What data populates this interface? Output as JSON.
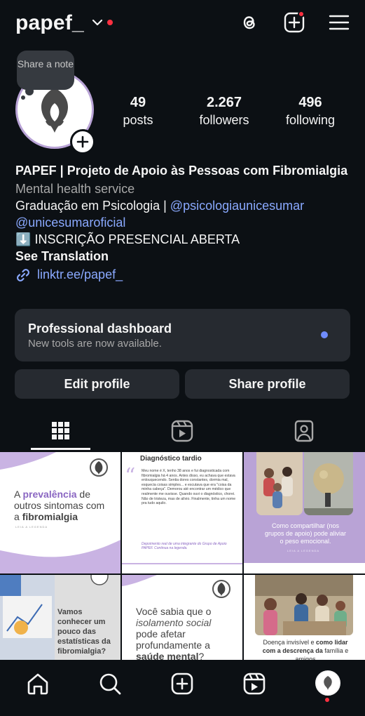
{
  "header": {
    "username": "papef_",
    "icons": [
      "chevron-down-icon",
      "threads-icon",
      "create-icon",
      "menu-icon"
    ]
  },
  "note": {
    "text": "Share a note"
  },
  "stats": [
    {
      "value": "49",
      "label": "posts"
    },
    {
      "value": "2.267",
      "label": "followers"
    },
    {
      "value": "496",
      "label": "following"
    }
  ],
  "bio": {
    "name": "PAPEF | Projeto de Apoio às Pessoas com Fibromialgia",
    "category": "Mental health service",
    "line1": "Graduação em Psicologia | ",
    "mention1": "@psicologiaunicesumar",
    "mention2": "@unicesumaroficial",
    "line3_emoji": "⬇️",
    "line3": "INSCRIÇÃO PRESENCIAL ABERTA",
    "see_translation": "See Translation",
    "link": "linktr.ee/papef_"
  },
  "dashboard": {
    "title": "Professional dashboard",
    "subtitle": "New tools are now available."
  },
  "buttons": {
    "edit": "Edit profile",
    "share": "Share profile"
  },
  "tabs": [
    "grid-icon",
    "reels-icon",
    "tagged-icon"
  ],
  "posts": [
    {
      "text_a": "A ",
      "text_b": "prevalência",
      "text_c": " de outros sintomas com a ",
      "text_d": "fibromialgia",
      "caption": "LEIA A LEGENDA"
    },
    {
      "title": "Diagnóstico tardio",
      "body": "Meu nome é X, tenho 38 anos e fui diagnosticada com fibromialgia há 4 anos. Antes disso, eu achava que estava enlouquecendo. Sentia dores constantes, dormia mal, esquecia coisas simples... e escutava que era \"coisa da minha cabeça\". Demorou até encontrar um médico que realmente me ouvisse. Quando ouvi o diagnóstico, chorei. Não de tristeza, mas de alívio. Finalmente, tinha um nome pra tudo aquilo.",
      "footer": "Depoimento real de uma integrante do Grupo de Apoio PAPEF. Continua na legenda."
    },
    {
      "text": "Como compartilhar (nos grupos de apoio) pode aliviar o peso emocional.",
      "caption": "LEIA A LEGENDA"
    },
    {
      "text": "Vamos conhecer um pouco das estatísticas da fibromialgia?"
    },
    {
      "text_a": "Você sabia que o ",
      "text_b": "isolamento social",
      "text_c": " pode afetar profundamente a ",
      "text_d": "saúde mental",
      "text_e": "?"
    },
    {
      "text_a": "Doença invisível e ",
      "text_b": "como lidar com a descrença da",
      "text_c": " família e amigos"
    }
  ],
  "nav": [
    "home-icon",
    "search-icon",
    "create-icon",
    "reels-icon",
    "profile-avatar"
  ],
  "colors": {
    "background": "#0c1014",
    "card": "#262a30",
    "link": "#8aa9ff",
    "notification": "#ff3040",
    "lavender": "#b9a3d6"
  }
}
